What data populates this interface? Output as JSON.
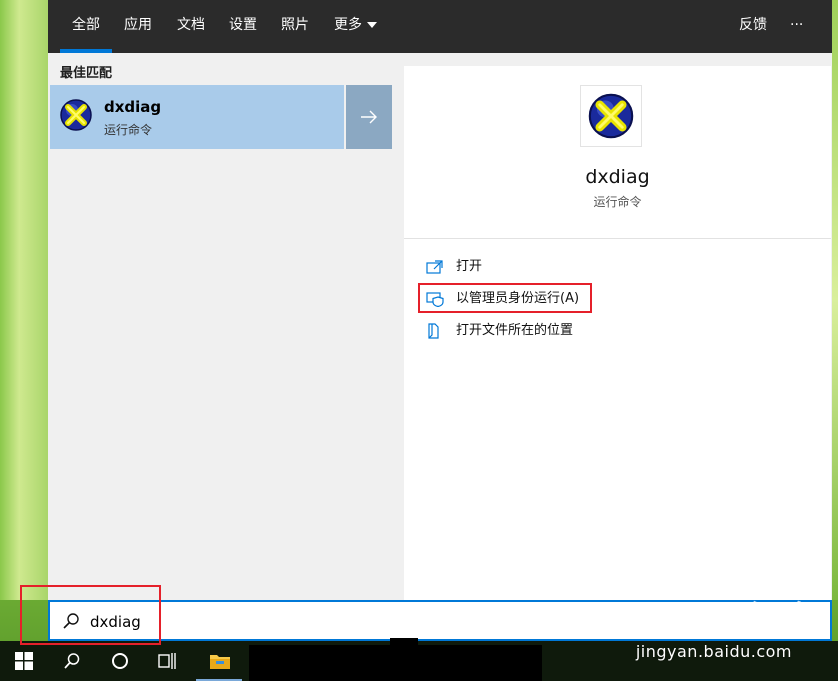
{
  "tabs": [
    {
      "label": "全部",
      "active": true
    },
    {
      "label": "应用"
    },
    {
      "label": "文档"
    },
    {
      "label": "设置"
    },
    {
      "label": "照片"
    },
    {
      "label": "更多"
    }
  ],
  "topbar": {
    "feedback_label": "反馈",
    "more_options_label": "···"
  },
  "best_match": {
    "section_title": "最佳匹配",
    "name": "dxdiag",
    "type": "运行命令"
  },
  "detail": {
    "name": "dxdiag",
    "type": "运行命令",
    "actions": [
      {
        "label": "打开",
        "icon": "open-icon"
      },
      {
        "label": "以管理员身份运行(A)",
        "icon": "shield-icon"
      },
      {
        "label": "打开文件所在的位置",
        "icon": "file-location-icon"
      }
    ]
  },
  "search": {
    "value": "dxdiag",
    "icon": "search-icon"
  },
  "taskbar": {
    "items": [
      "windows-start-icon",
      "search-icon",
      "cortana-icon",
      "task-view-icon",
      "file-explorer-icon"
    ]
  },
  "watermark": {
    "logo": "Baidu经验",
    "text": "jingyan.baidu.com"
  },
  "colors": {
    "accent": "#0078d7",
    "selected": "#a9cbea",
    "highlight": "#e5202a"
  }
}
